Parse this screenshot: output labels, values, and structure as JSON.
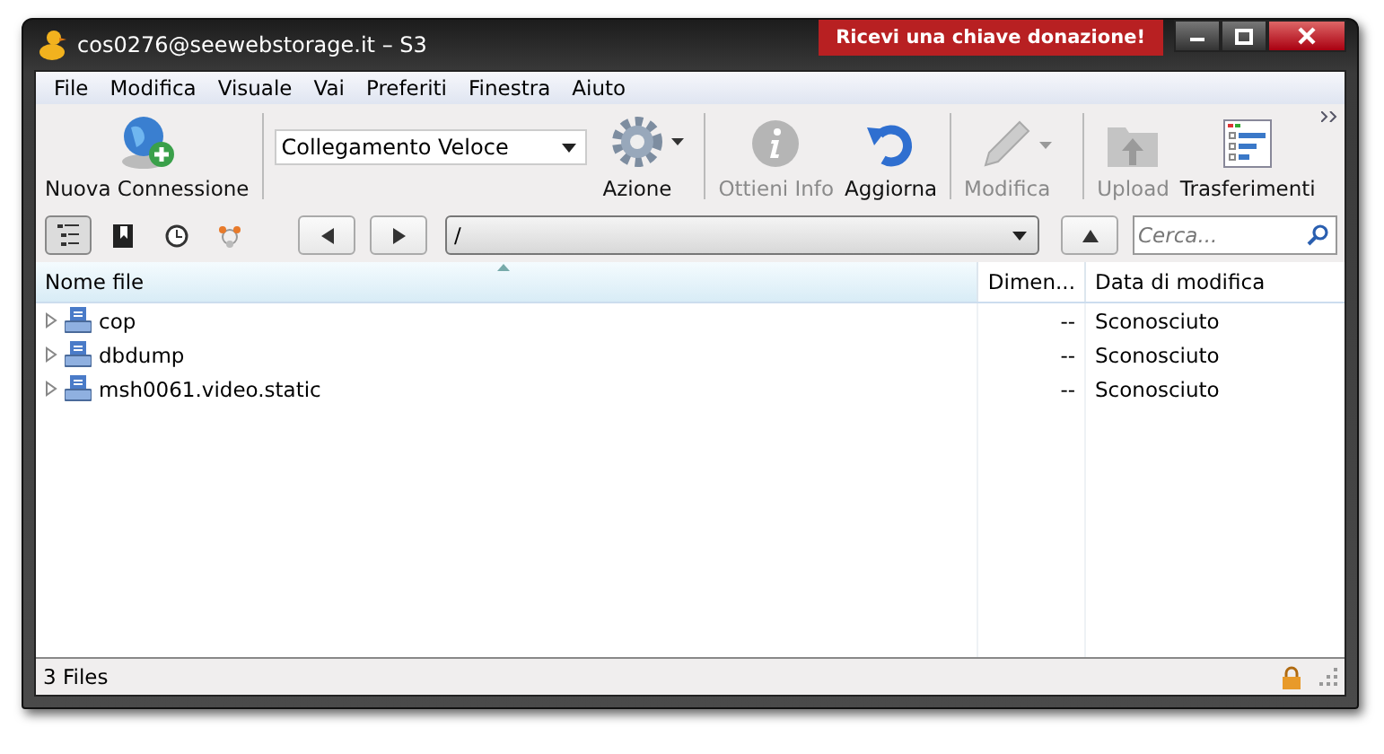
{
  "window": {
    "title": "cos0276@seewebstorage.it – S3",
    "donation_button": "Ricevi una chiave donazione!"
  },
  "menu": [
    "File",
    "Modifica",
    "Visuale",
    "Vai",
    "Preferiti",
    "Finestra",
    "Aiuto"
  ],
  "toolbar": [
    {
      "kind": "button",
      "label": "Nuova Connessione",
      "disabled": false
    },
    {
      "kind": "combo",
      "value": "Collegamento Veloce"
    },
    {
      "kind": "button",
      "label": "Azione",
      "disabled": false,
      "dropdown": true
    },
    {
      "kind": "button",
      "label": "Ottieni Info",
      "disabled": true
    },
    {
      "kind": "button",
      "label": "Aggiorna",
      "disabled": false
    },
    {
      "kind": "button",
      "label": "Modifica",
      "disabled": true,
      "dropdown": true
    },
    {
      "kind": "button",
      "label": "Upload",
      "disabled": true
    },
    {
      "kind": "button",
      "label": "Trasferimenti",
      "disabled": false
    }
  ],
  "view_buttons": [
    {
      "selected": true
    },
    {
      "selected": false
    },
    {
      "selected": false
    },
    {
      "selected": false
    }
  ],
  "path": "/",
  "search": {
    "placeholder": "Cerca..."
  },
  "table": {
    "columns": [
      "Nome file",
      "Dimen...",
      "Data di modifica"
    ],
    "rows": [
      {
        "name": "cop",
        "size": "--",
        "modified": "Sconosciuto",
        "expanded": false
      },
      {
        "name": "dbdump",
        "size": "--",
        "modified": "Sconosciuto",
        "expanded": false
      },
      {
        "name": "msh0061.video.static",
        "size": "--",
        "modified": "Sconosciuto",
        "expanded": false
      }
    ]
  },
  "status_bar": "3 Files"
}
